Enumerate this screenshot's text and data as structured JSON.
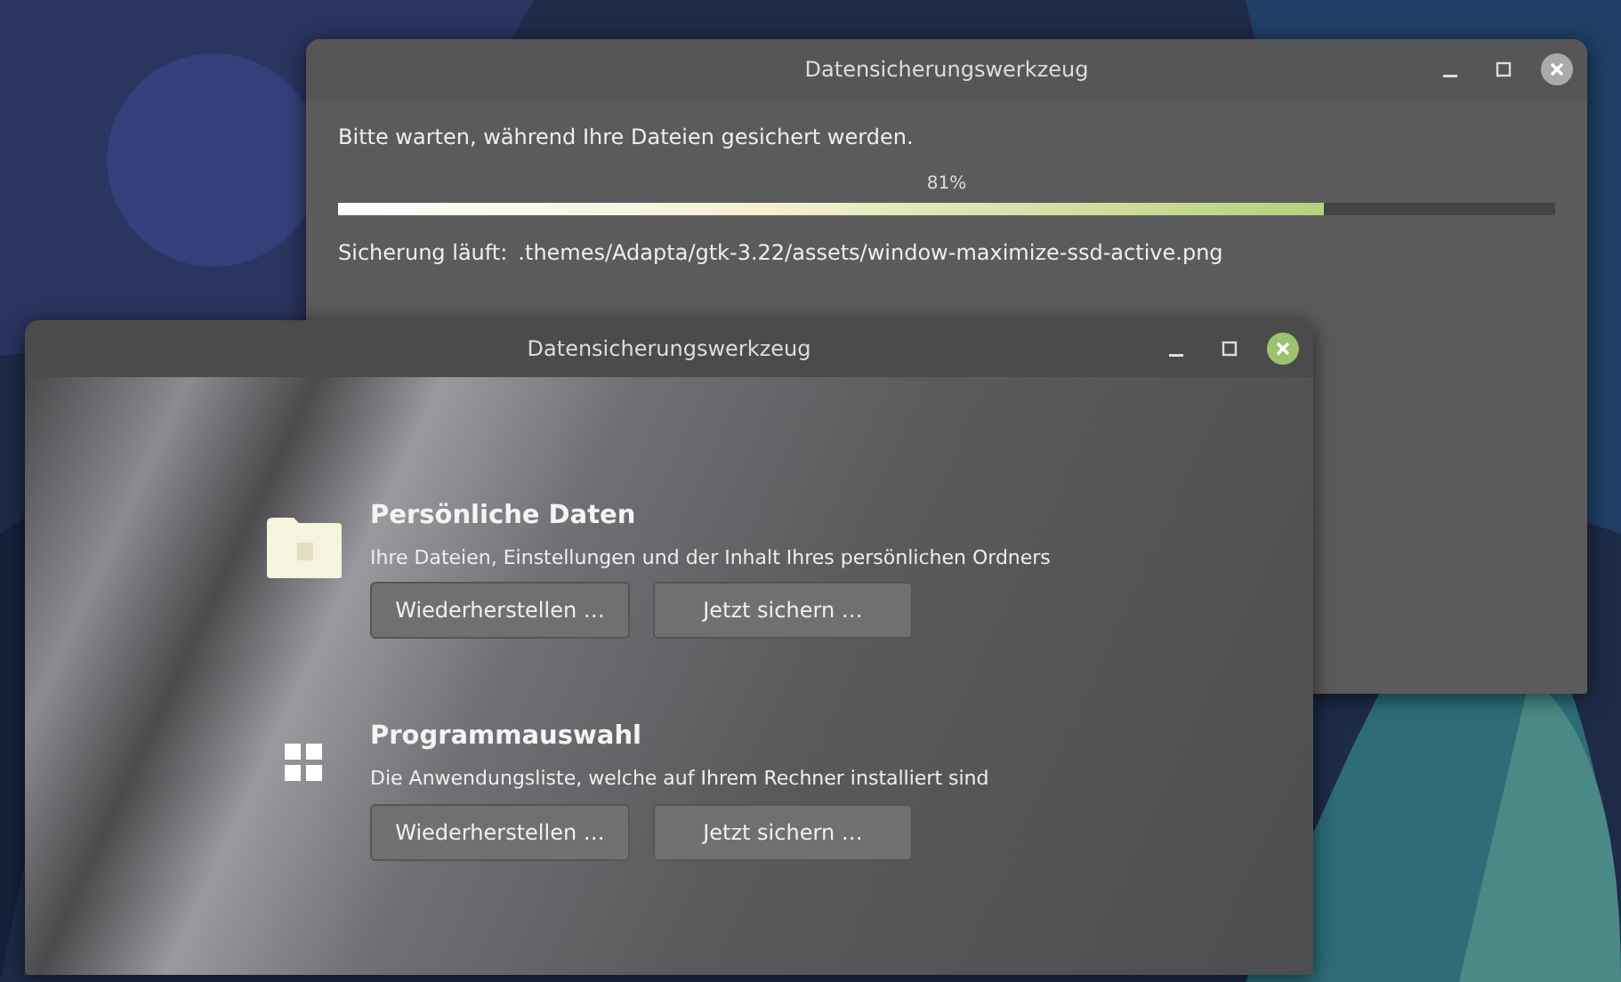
{
  "windows": [
    {
      "title": "Datensicherungswerkzeug",
      "focused": false,
      "kind": "progress",
      "message": "Bitte warten, während Ihre Dateien gesichert werden.",
      "progress": {
        "label": "81%",
        "level": 0.81
      },
      "status_label": "Sicherung läuft:",
      "status_file": ".themes/Adapta/gtk-3.22/assets/window-maximize-ssd-active.png"
    },
    {
      "title": "Datensicherungswerkzeug",
      "focused": true,
      "kind": "main",
      "sections": [
        {
          "kind": "folder",
          "title": "Persönliche Daten",
          "description": "Ihre Dateien, Einstellungen und der Inhalt Ihres persönlichen Ordners",
          "buttons": [
            "Wiederherstellen …",
            "Jetzt sichern …"
          ]
        },
        {
          "kind": "apps",
          "title": "Programmauswahl",
          "description": "Die Anwendungsliste, welche auf Ihrem Rechner installiert sind",
          "buttons": [
            "Wiederherstellen …",
            "Jetzt sichern …"
          ]
        }
      ]
    }
  ]
}
